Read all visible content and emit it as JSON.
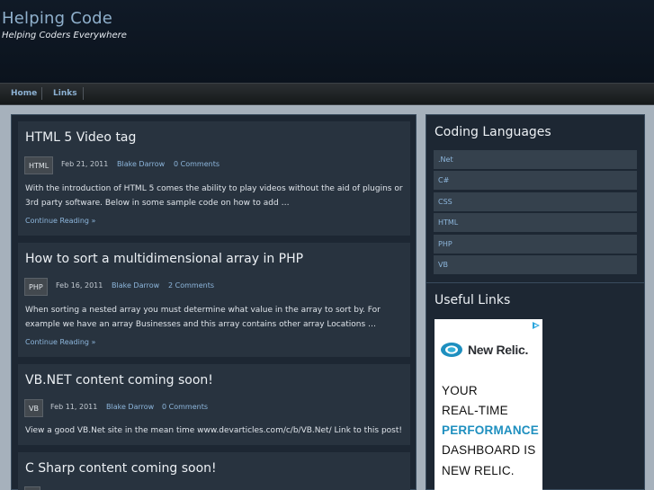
{
  "site": {
    "title": "Helping Code",
    "tagline": "Helping Coders Everywhere"
  },
  "nav": {
    "items": [
      {
        "label": "Home"
      },
      {
        "label": "Links"
      }
    ]
  },
  "posts": [
    {
      "title": "HTML 5 Video tag",
      "category": "HTML",
      "date": "Feb 21, 2011",
      "author": "Blake Darrow",
      "comments": "0 Comments",
      "excerpt": "With the introduction of HTML 5 comes the ability to play videos without the aid of plugins or 3rd party software. Below in some sample code on how to add …",
      "more": "Continue Reading »"
    },
    {
      "title": "How to sort a multidimensional array in PHP",
      "category": "PHP",
      "date": "Feb 16, 2011",
      "author": "Blake Darrow",
      "comments": "2 Comments",
      "excerpt": "When sorting a nested array you must determine what value in the array to sort by. For example we have an array Businesses and this array contains other array Locations …",
      "more": "Continue Reading »"
    },
    {
      "title": "VB.NET content coming soon!",
      "category": "VB",
      "date": "Feb 11, 2011",
      "author": "Blake Darrow",
      "comments": "0 Comments",
      "excerpt": "View a good VB.Net site in the mean time www.devarticles.com/c/b/VB.Net/ Link to this post!"
    },
    {
      "title": "C Sharp content coming soon!"
    }
  ],
  "sidebar": {
    "languages_heading": "Coding Languages",
    "languages": [
      ".Net",
      "C#",
      "CSS",
      "HTML",
      "PHP",
      "VB"
    ],
    "links_heading": "Useful Links",
    "ad": {
      "brand": "New Relic.",
      "lines": [
        "YOUR",
        "REAL-TIME",
        "PERFORMANCE",
        "DASHBOARD IS",
        "NEW RELIC."
      ],
      "brand_color": "#1e8fbf"
    }
  }
}
